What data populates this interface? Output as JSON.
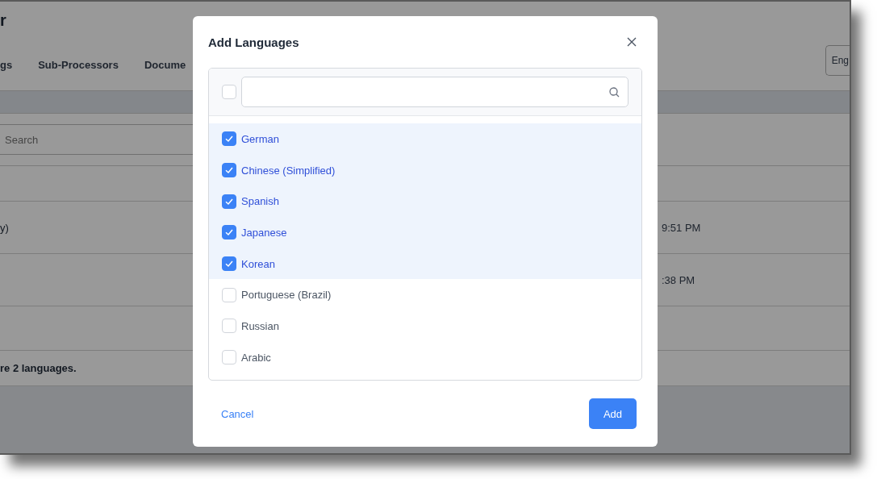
{
  "page": {
    "title": "r",
    "tabs": [
      {
        "label": "gs"
      },
      {
        "label": "Sub-Processors"
      },
      {
        "label": "Docume"
      }
    ],
    "language_select": "Eng",
    "search": {
      "placeholder": "Search"
    },
    "rows": [
      {
        "column_1": "y)",
        "column_2": "9:51 PM"
      },
      {
        "column_2": ":38 PM"
      }
    ],
    "footer_note": "re 2 languages."
  },
  "dialog": {
    "title": "Add Languages",
    "select_all": {
      "checked": false
    },
    "options": [
      {
        "label": "German",
        "checked": true
      },
      {
        "label": "Chinese (Simplified)",
        "checked": true
      },
      {
        "label": "Spanish",
        "checked": true
      },
      {
        "label": "Japanese",
        "checked": true
      },
      {
        "label": "Korean",
        "checked": true
      },
      {
        "label": "Portuguese (Brazil)",
        "checked": false
      },
      {
        "label": "Russian",
        "checked": false
      },
      {
        "label": "Arabic",
        "checked": false
      }
    ],
    "cancel": "Cancel",
    "confirm": "Add"
  }
}
